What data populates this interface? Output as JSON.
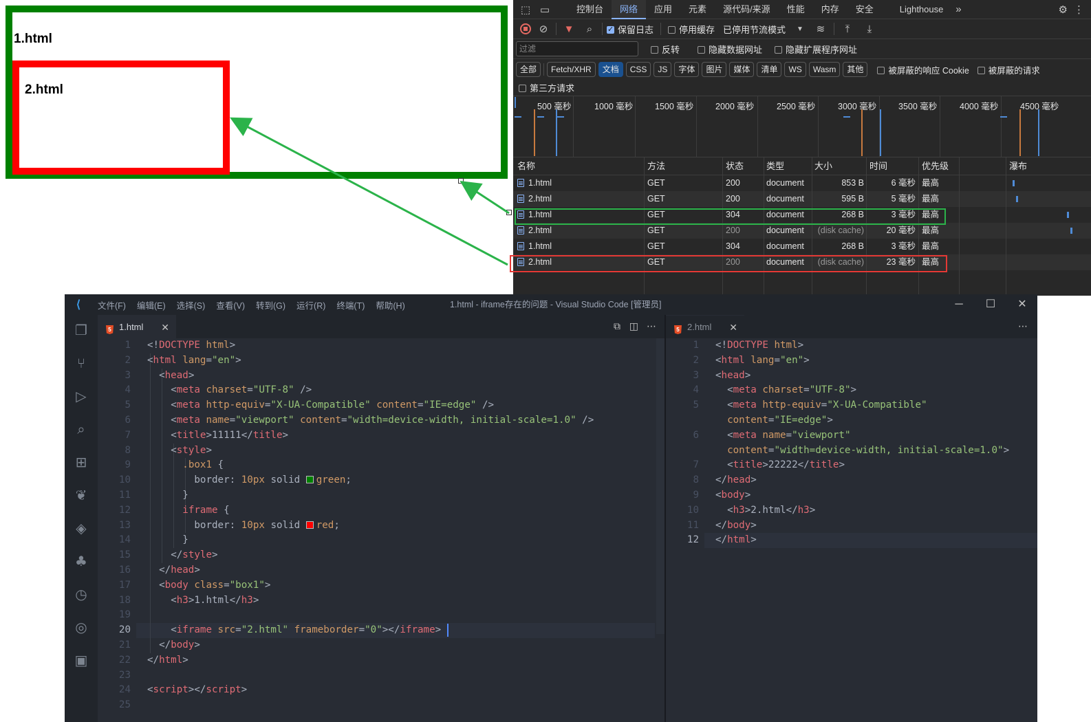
{
  "preview": {
    "outer_heading": "1.html",
    "inner_heading": "2.html",
    "outer_border_color": "#008000",
    "inner_border_color": "#ff0000"
  },
  "devtools": {
    "tabs": [
      "控制台",
      "网络",
      "应用",
      "元素",
      "源代码/来源",
      "性能",
      "内存",
      "安全",
      "Lighthouse"
    ],
    "active_tab": "网络",
    "more_tabs_icon": "chevron-double-right-icon",
    "toolbar": {
      "preserve_log": "保留日志",
      "disable_cache": "停用缓存",
      "throttling": "已停用节流模式"
    },
    "filter": {
      "placeholder": "过滤",
      "invert": "反转",
      "hide_data_urls": "隐藏数据网址",
      "hide_extension_urls": "隐藏扩展程序网址"
    },
    "type_filters": [
      "全部",
      "Fetch/XHR",
      "文档",
      "CSS",
      "JS",
      "字体",
      "图片",
      "媒体",
      "清单",
      "WS",
      "Wasm",
      "其他"
    ],
    "active_type_filter": "文档",
    "blocked_cookies": "被屏蔽的响应 Cookie",
    "blocked_requests": "被屏蔽的请求",
    "third_party": "第三方请求",
    "timeline_labels": [
      "500 毫秒",
      "1000 毫秒",
      "1500 毫秒",
      "2000 毫秒",
      "2500 毫秒",
      "3000 毫秒",
      "3500 毫秒",
      "4000 毫秒",
      "4500 毫秒"
    ],
    "columns": [
      "名称",
      "方法",
      "状态",
      "类型",
      "大小",
      "时间",
      "优先级",
      "瀑布"
    ],
    "rows": [
      {
        "name": "1.html",
        "method": "GET",
        "status": "200",
        "type": "document",
        "size": "853 B",
        "time": "6 毫秒",
        "priority": "最高"
      },
      {
        "name": "2.html",
        "method": "GET",
        "status": "200",
        "type": "document",
        "size": "595 B",
        "time": "5 毫秒",
        "priority": "最高"
      },
      {
        "name": "1.html",
        "method": "GET",
        "status": "304",
        "type": "document",
        "size": "268 B",
        "time": "3 毫秒",
        "priority": "最高"
      },
      {
        "name": "2.html",
        "method": "GET",
        "status": "200",
        "type": "document",
        "size": "(disk cache)",
        "time": "20 毫秒",
        "priority": "最高"
      },
      {
        "name": "1.html",
        "method": "GET",
        "status": "304",
        "type": "document",
        "size": "268 B",
        "time": "3 毫秒",
        "priority": "最高"
      },
      {
        "name": "2.html",
        "method": "GET",
        "status": "200",
        "type": "document",
        "size": "(disk cache)",
        "time": "23 毫秒",
        "priority": "最高"
      }
    ]
  },
  "vscode": {
    "menu": [
      "文件(F)",
      "编辑(E)",
      "选择(S)",
      "查看(V)",
      "转到(G)",
      "运行(R)",
      "终端(T)",
      "帮助(H)"
    ],
    "window_title": "1.html - iframe存在的问题 - Visual Studio Code [管理员]",
    "left_tab": "1.html",
    "right_tab": "2.html",
    "left_lines": [
      "1",
      "2",
      "3",
      "4",
      "5",
      "6",
      "7",
      "8",
      "9",
      "10",
      "11",
      "12",
      "13",
      "14",
      "15",
      "16",
      "17",
      "18",
      "19",
      "20",
      "21",
      "22",
      "23",
      "24",
      "25"
    ],
    "left_current_line": "20",
    "right_lines": [
      "1",
      "2",
      "3",
      "4",
      "5",
      "",
      "6",
      "",
      "7",
      "8",
      "9",
      "10",
      "11",
      "12"
    ],
    "right_current_line": "12",
    "left_code": {
      "l1": [
        "<!",
        "DOCTYPE",
        " ",
        "html",
        ">"
      ],
      "l2": [
        "<",
        "html",
        " ",
        "lang",
        "=",
        "\"en\"",
        ">"
      ],
      "l3": [
        "<",
        "head",
        ">"
      ],
      "l4": [
        "<",
        "meta",
        " ",
        "charset",
        "=",
        "\"UTF-8\"",
        " />"
      ],
      "l5": [
        "<",
        "meta",
        " ",
        "http-equiv",
        "=",
        "\"X-UA-Compatible\"",
        " ",
        "content",
        "=",
        "\"IE=edge\"",
        " />"
      ],
      "l6": [
        "<",
        "meta",
        " ",
        "name",
        "=",
        "\"viewport\"",
        " ",
        "content",
        "=",
        "\"width=device-width, initial-scale=1.0\"",
        " />"
      ],
      "l7": [
        "<",
        "title",
        ">",
        "11111",
        "</",
        "title",
        ">"
      ],
      "l8": [
        "<",
        "style",
        ">"
      ],
      "l9": [
        ".box1",
        " {"
      ],
      "l10": [
        "border",
        ": ",
        "10px",
        " solid ",
        "green",
        ";"
      ],
      "l11": [
        "}"
      ],
      "l12": [
        "iframe",
        " {"
      ],
      "l13": [
        "border",
        ": ",
        "10px",
        " solid ",
        "red",
        ";"
      ],
      "l14": [
        "}"
      ],
      "l15": [
        "</",
        "style",
        ">"
      ],
      "l16": [
        "</",
        "head",
        ">"
      ],
      "l17": [
        "<",
        "body",
        " ",
        "class",
        "=",
        "\"box1\"",
        ">"
      ],
      "l18": [
        "<",
        "h3",
        ">",
        "1.html",
        "</",
        "h3",
        ">"
      ],
      "l20": [
        "<",
        "iframe",
        " ",
        "src",
        "=",
        "\"2.html\"",
        " ",
        "frameborder",
        "=",
        "\"0\"",
        "></",
        "iframe",
        ">"
      ],
      "l21": [
        "</",
        "body",
        ">"
      ],
      "l22": [
        "</",
        "html",
        ">"
      ],
      "l24": [
        "<",
        "script",
        "></",
        "script",
        ">"
      ]
    },
    "right_code": {
      "r1": [
        "<!",
        "DOCTYPE",
        " ",
        "html",
        ">"
      ],
      "r2": [
        "<",
        "html",
        " ",
        "lang",
        "=",
        "\"en\"",
        ">"
      ],
      "r3": [
        "<",
        "head",
        ">"
      ],
      "r4": [
        "<",
        "meta",
        " ",
        "charset",
        "=",
        "\"UTF-8\"",
        ">"
      ],
      "r5": [
        "<",
        "meta",
        " ",
        "http-equiv",
        "=",
        "\"X-UA-Compatible\""
      ],
      "r5b": [
        "content",
        "=",
        "\"IE=edge\"",
        ">"
      ],
      "r6": [
        "<",
        "meta",
        " ",
        "name",
        "=",
        "\"viewport\""
      ],
      "r6b": [
        "content",
        "=",
        "\"width=device-width, initial-scale=1.0\"",
        ">"
      ],
      "r7": [
        "<",
        "title",
        ">",
        "22222",
        "</",
        "title",
        ">"
      ],
      "r8": [
        "</",
        "head",
        ">"
      ],
      "r9": [
        "<",
        "body",
        ">"
      ],
      "r10": [
        "<",
        "h3",
        ">",
        "2.html",
        "</",
        "h3",
        ">"
      ],
      "r11": [
        "</",
        "body",
        ">"
      ],
      "r12": [
        "</",
        "html",
        ">"
      ]
    }
  }
}
